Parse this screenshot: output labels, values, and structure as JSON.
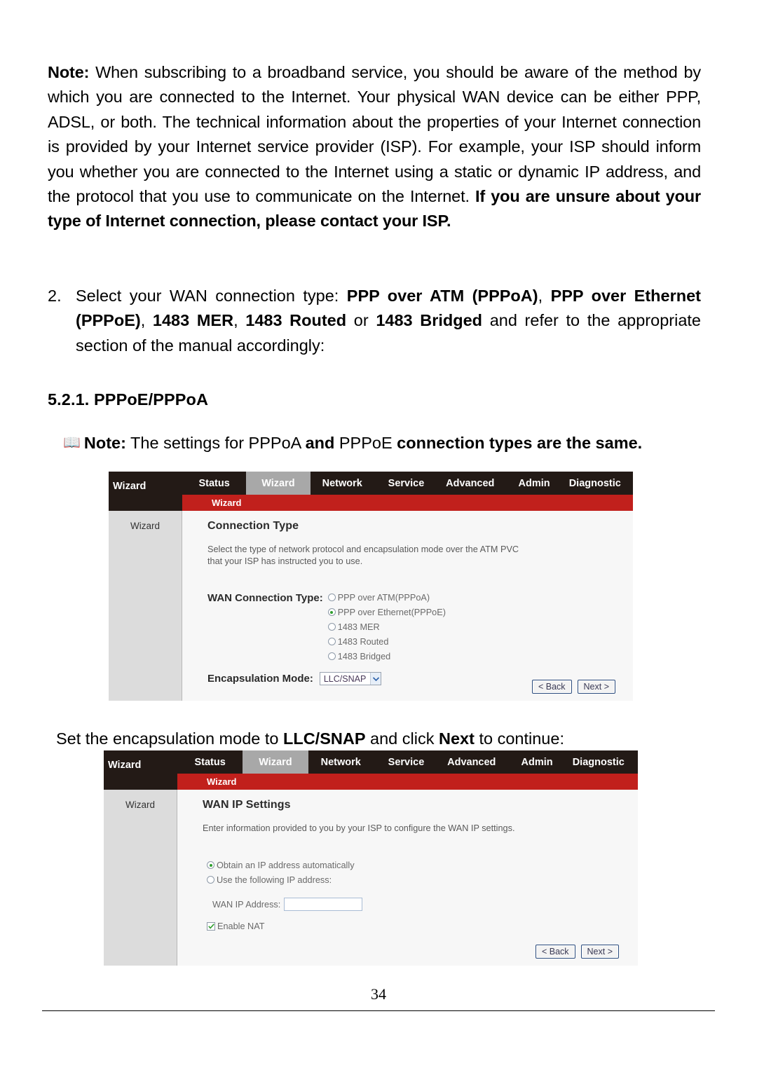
{
  "document": {
    "page_number": "34",
    "note_paragraph": {
      "lead": "Note:",
      "body_normal_1": " When subscribing to a broadband service, you should be aware of the method by which you are connected to the Internet. Your physical WAN device can be either PPP, ADSL, or both. The technical information about the properties of your Internet connection is provided by your Internet service provider (ISP). For example, your ISP should inform you whether you are connected to the Internet using a static or dynamic IP address, and the protocol that you use to communicate on the Internet. ",
      "body_bold_1": "If you are unsure about your type of Internet connection, please contact your ISP."
    },
    "list_item": {
      "number": "2.",
      "text_1": "Select your WAN connection type: ",
      "bold_1": "PPP over ATM (PPPoA)",
      "text_2": ", ",
      "bold_2": "PPP over Ethernet (PPPoE)",
      "text_3": ", ",
      "bold_3": "1483 MER",
      "text_4": ", ",
      "bold_4": "1483 Routed",
      "text_5": " or ",
      "bold_5": "1483 Bridged",
      "text_6": " and refer to the appropriate section of the manual accordingly:"
    },
    "heading": "5.2.1. PPPoE/PPPoA",
    "book_note": {
      "icon": "book-icon",
      "lead": "Note:",
      "text_1": " The settings for PPPoA ",
      "bold_1": "and",
      "text_2": " PPPoE ",
      "bold_2": "connection types are the same."
    },
    "encapsulation_instruction": {
      "text_1": "Set the encapsulation mode to ",
      "bold_1": "LLC/SNAP",
      "text_2": " and click ",
      "bold_2": "Next",
      "text_3": " to continue:"
    }
  },
  "screenshot_connection_type": {
    "brand": "Wizard",
    "tabs": [
      {
        "label": "Status",
        "active": false
      },
      {
        "label": "Wizard",
        "active": true
      },
      {
        "label": "Network",
        "active": false
      },
      {
        "label": "Service",
        "active": false
      },
      {
        "label": "Advanced",
        "active": false
      },
      {
        "label": "Admin",
        "active": false
      },
      {
        "label": "Diagnostic",
        "active": false
      }
    ],
    "subbar_label": "Wizard",
    "sidenav_item": "Wizard",
    "title": "Connection Type",
    "description": "Select the type of network protocol and encapsulation mode over the ATM PVC that your ISP has instructed you to use.",
    "wan_connection_type_label": "WAN Connection Type:",
    "wan_connection_type_options": [
      {
        "label": "PPP over ATM(PPPoA)",
        "selected": false
      },
      {
        "label": "PPP over Ethernet(PPPoE)",
        "selected": true
      },
      {
        "label": "1483 MER",
        "selected": false
      },
      {
        "label": "1483 Routed",
        "selected": false
      },
      {
        "label": "1483 Bridged",
        "selected": false
      }
    ],
    "encapsulation_mode_label": "Encapsulation Mode:",
    "encapsulation_mode_value": "LLC/SNAP",
    "back_button": "< Back",
    "next_button": "Next >"
  },
  "screenshot_wan_ip": {
    "brand": "Wizard",
    "tabs": [
      {
        "label": "Status",
        "active": false
      },
      {
        "label": "Wizard",
        "active": true
      },
      {
        "label": "Network",
        "active": false
      },
      {
        "label": "Service",
        "active": false
      },
      {
        "label": "Advanced",
        "active": false
      },
      {
        "label": "Admin",
        "active": false
      },
      {
        "label": "Diagnostic",
        "active": false
      }
    ],
    "subbar_label": "Wizard",
    "sidenav_item": "Wizard",
    "title": "WAN IP Settings",
    "description": "Enter information provided to you by your ISP to configure the WAN IP settings.",
    "ip_mode_options": [
      {
        "label": "Obtain an IP address automatically",
        "selected": true
      },
      {
        "label": "Use the following IP address:",
        "selected": false
      }
    ],
    "wan_ip_address_label": "WAN IP Address:",
    "wan_ip_address_value": "",
    "enable_nat_label": "Enable NAT",
    "enable_nat_checked": true,
    "back_button": "< Back",
    "next_button": "Next >"
  },
  "colors": {
    "nav_dark": "#231a16",
    "nav_active": "#a8a8a8",
    "subbar_red": "#c1201c",
    "sidenav_gray": "#dcdcdc",
    "radio_selected_green": "#2e9e2e",
    "button_border_blue": "#2b4c7e"
  }
}
